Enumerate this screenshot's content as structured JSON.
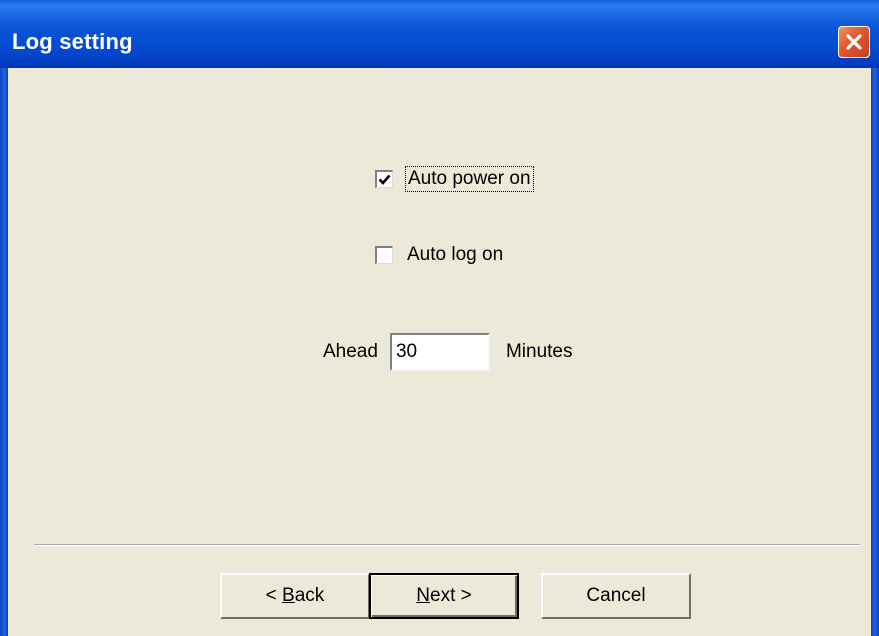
{
  "window": {
    "title": "Log setting"
  },
  "options": {
    "auto_power_on": {
      "label": "Auto power on",
      "checked": true
    },
    "auto_log_on": {
      "label": "Auto log on",
      "checked": false
    }
  },
  "ahead": {
    "label": "Ahead",
    "value": "30",
    "unit": "Minutes"
  },
  "buttons": {
    "back": {
      "prefix": "< ",
      "mnemonic": "B",
      "rest": "ack"
    },
    "next": {
      "mnemonic": "N",
      "rest": "ext >"
    },
    "cancel": "Cancel"
  },
  "icons": {
    "close": "close-icon",
    "check": "checkmark-icon"
  }
}
